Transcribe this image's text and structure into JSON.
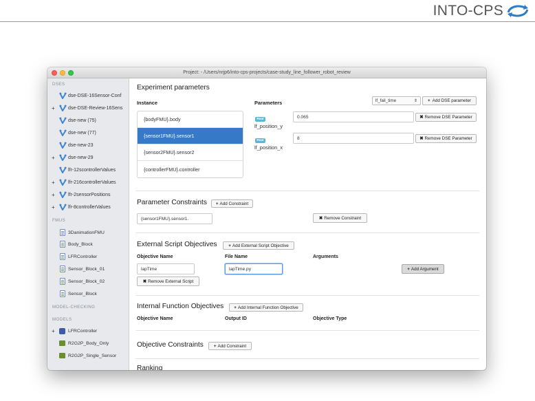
{
  "brand": {
    "name": "INTO-CPS"
  },
  "window": {
    "title": "Project: - /Users/nrjp6/into-cps-projects/case-study_line_follower_robot_review"
  },
  "sidebar": {
    "sections": {
      "dses": "DSES",
      "fmus": "FMUS",
      "model_checking": "MODEL-CHECKING",
      "models": "MODELS"
    },
    "dse_items": [
      {
        "label": "dse-DSE-16Sensor-Conf",
        "expandable": false
      },
      {
        "label": "dse-DSE-Review-16Sens",
        "expandable": true
      },
      {
        "label": "dse-new (75)",
        "expandable": false
      },
      {
        "label": "dse-new (77)",
        "expandable": false
      },
      {
        "label": "dse-new-23",
        "expandable": false
      },
      {
        "label": "dse-new-29",
        "expandable": true
      },
      {
        "label": "lfr-12scontrollerValues",
        "expandable": false
      },
      {
        "label": "lfr-216controllerValues",
        "expandable": true
      },
      {
        "label": "lfr-2sensorPositions",
        "expandable": true
      },
      {
        "label": "lfr-8controllerValues",
        "expandable": true
      }
    ],
    "fmu_items": [
      "3DanimationFMU",
      "Body_Block",
      "LFRController",
      "Sensor_Block_01",
      "Sensor_Block_02",
      "Sensor_Block"
    ],
    "model_items": [
      {
        "label": "LFRController",
        "expandable": true
      },
      {
        "label": "R2G2P_Body_Only",
        "expandable": false
      },
      {
        "label": "R2G2P_Single_Sensor",
        "expandable": false
      }
    ]
  },
  "experiment": {
    "title": "Experiment parameters",
    "instance_header": "Instance",
    "parameters_header": "Parameters",
    "instances": [
      "{bodyFMU}.body",
      "{sensor1FMU}.sensor1",
      "{sensor2FMU}.sensor2",
      "{controllerFMU}.controller"
    ],
    "selected_instance": 1,
    "param_select_value": "lf_fail_time",
    "add_dse_param_label": "Add DSE parameter",
    "params": [
      {
        "type_tag": "Real",
        "name": "lf_position_y",
        "value": "0.065",
        "remove_label": "Remove DSE Parameter"
      },
      {
        "type_tag": "Real",
        "name": "lf_position_x",
        "value": "8",
        "remove_label": "Remove DSE Parameter"
      }
    ]
  },
  "constraints": {
    "title": "Parameter Constraints",
    "add_label": "Add Constraint",
    "value": "{sensor1FMU}.sensor1.",
    "remove_label": "Remove Constraint"
  },
  "external_objectives": {
    "title": "External Script Objectives",
    "add_label": "Add External Script Objective",
    "col_objective": "Objective Name",
    "col_file": "File Name",
    "col_args": "Arguments",
    "objective_value": "lapTime",
    "file_value": "lapTime.py",
    "add_argument_label": "Add Argument",
    "remove_label": "Remove External Script"
  },
  "internal_objectives": {
    "title": "Internal Function Objectives",
    "add_label": "Add Internal Function Objective",
    "col_objective": "Objective Name",
    "col_output": "Output ID",
    "col_type": "Objective Type"
  },
  "objective_constraints": {
    "title": "Objective Constraints",
    "add_label": "Add Constraint"
  },
  "ranking": {
    "title": "Ranking"
  },
  "colors": {
    "accent": "#3579c7",
    "tag": "#5fb3d6",
    "sidebar": "#e7e9ec"
  }
}
